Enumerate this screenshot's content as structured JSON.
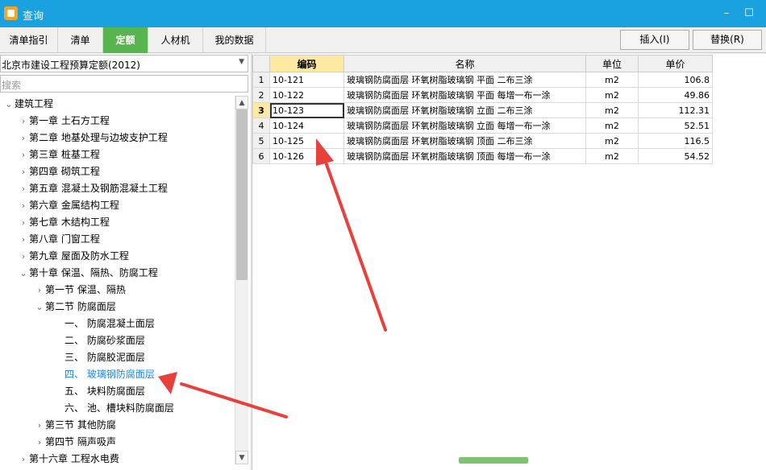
{
  "window": {
    "title": "查询",
    "minimize": "–",
    "maximize": "☐",
    "close": "✕"
  },
  "tabs": [
    {
      "label": "清单指引",
      "active": false
    },
    {
      "label": "清单",
      "active": false
    },
    {
      "label": "定额",
      "active": true
    },
    {
      "label": "人材机",
      "active": false
    },
    {
      "label": "我的数据",
      "active": false
    }
  ],
  "toolbar": {
    "insert_label": "插入(I)",
    "replace_label": "替换(R)"
  },
  "left": {
    "library_select": "北京市建设工程预算定额(2012)",
    "search_placeholder": "搜索",
    "tree": [
      {
        "label": "建筑工程",
        "level": 0,
        "expanded": true
      },
      {
        "label": "第一章 土石方工程",
        "level": 1,
        "expanded": false
      },
      {
        "label": "第二章 地基处理与边坡支护工程",
        "level": 1,
        "expanded": false
      },
      {
        "label": "第三章 桩基工程",
        "level": 1,
        "expanded": false
      },
      {
        "label": "第四章 砌筑工程",
        "level": 1,
        "expanded": false
      },
      {
        "label": "第五章 混凝土及钢筋混凝土工程",
        "level": 1,
        "expanded": false
      },
      {
        "label": "第六章 金属结构工程",
        "level": 1,
        "expanded": false
      },
      {
        "label": "第七章 木结构工程",
        "level": 1,
        "expanded": false
      },
      {
        "label": "第八章 门窗工程",
        "level": 1,
        "expanded": false
      },
      {
        "label": "第九章 屋面及防水工程",
        "level": 1,
        "expanded": false
      },
      {
        "label": "第十章 保温、隔热、防腐工程",
        "level": 1,
        "expanded": true
      },
      {
        "label": "第一节 保温、隔热",
        "level": 2,
        "expanded": false
      },
      {
        "label": "第二节 防腐面层",
        "level": 2,
        "expanded": true
      },
      {
        "label": "一、 防腐混凝土面层",
        "level": 3
      },
      {
        "label": "二、 防腐砂浆面层",
        "level": 3
      },
      {
        "label": "三、 防腐胶泥面层",
        "level": 3
      },
      {
        "label": "四、 玻璃钢防腐面层",
        "level": 3,
        "selected": true
      },
      {
        "label": "五、 块料防腐面层",
        "level": 3
      },
      {
        "label": "六、 池、槽块料防腐面层",
        "level": 3
      },
      {
        "label": "第三节 其他防腐",
        "level": 2,
        "expanded": false
      },
      {
        "label": "第四节 隔声吸声",
        "level": 2,
        "expanded": false
      },
      {
        "label": "第十六章 工程水电费",
        "level": 1,
        "expanded": false
      }
    ]
  },
  "grid": {
    "headers": {
      "code": "编码",
      "name": "名称",
      "unit": "单位",
      "price": "单价"
    },
    "rows": [
      {
        "no": "1",
        "code": "10-121",
        "name": "玻璃钢防腐面层 环氧树脂玻璃钢 平面 二布三涂",
        "unit": "m2",
        "price": "106.8"
      },
      {
        "no": "2",
        "code": "10-122",
        "name": "玻璃钢防腐面层 环氧树脂玻璃钢 平面 每增一布一涂",
        "unit": "m2",
        "price": "49.86"
      },
      {
        "no": "3",
        "code": "10-123",
        "name": "玻璃钢防腐面层 环氧树脂玻璃钢 立面 二布三涂",
        "unit": "m2",
        "price": "112.31",
        "current": true
      },
      {
        "no": "4",
        "code": "10-124",
        "name": "玻璃钢防腐面层 环氧树脂玻璃钢 立面 每增一布一涂",
        "unit": "m2",
        "price": "52.51"
      },
      {
        "no": "5",
        "code": "10-125",
        "name": "玻璃钢防腐面层 环氧树脂玻璃钢 顶面 二布三涂",
        "unit": "m2",
        "price": "116.5"
      },
      {
        "no": "6",
        "code": "10-126",
        "name": "玻璃钢防腐面层 环氧树脂玻璃钢 顶面 每增一布一涂",
        "unit": "m2",
        "price": "54.52"
      }
    ]
  },
  "colors": {
    "titlebar": "#1aa1e0",
    "active_tab": "#58b54d",
    "header_highlight": "#fde9a0",
    "selected_tree_text": "#1e88e5",
    "annotation_arrow": "#e8413c"
  }
}
